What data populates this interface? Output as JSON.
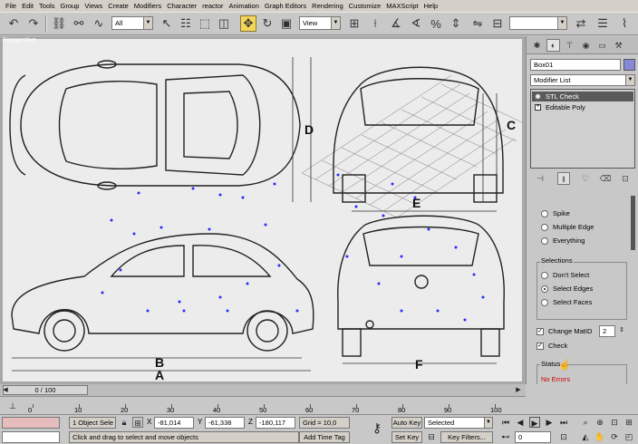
{
  "menu": [
    "File",
    "Edit",
    "Tools",
    "Group",
    "Views",
    "Create",
    "Modifiers",
    "Character",
    "reactor",
    "Animation",
    "Graph Editors",
    "Rendering",
    "Customize",
    "MAXScript",
    "Help"
  ],
  "toolbar": {
    "selection_filter": "All",
    "ref_coord": "View",
    "named_sets": ""
  },
  "viewport": {
    "label": "Perspective",
    "blueprint_labels": {
      "top_dim": "D",
      "front_dim": "C",
      "front_width": "E",
      "side_len_b": "B",
      "side_len_a": "A",
      "rear_width": "F"
    }
  },
  "panel": {
    "object_name": "Box01",
    "object_color": "#8888d8",
    "modifier_list": "Modifier List",
    "stack": [
      "STL Check",
      "Editable Poly"
    ],
    "check_options": [
      "Spike",
      "Multiple Edge",
      "Everything"
    ],
    "selections_label": "Selections",
    "selections": [
      "Don't Select",
      "Select Edges",
      "Select Faces"
    ],
    "selected_option": "Select Edges",
    "change_matid_label": "Change MatID",
    "change_matid_value": "2",
    "check_label": "Check",
    "status_label": "Status",
    "status_text": "No Errors",
    "status_color": "#cc0000"
  },
  "time": {
    "frame": "0 / 100",
    "ticks": [
      "0",
      "10",
      "20",
      "30",
      "40",
      "50",
      "60",
      "70",
      "80",
      "90",
      "100"
    ]
  },
  "status": {
    "selection": "1 Object Sele",
    "x": "-81,014",
    "y": "-61,338",
    "z": "-180,117",
    "grid": "Grid = 10,0",
    "prompt": "Click and drag to select and move objects",
    "add_time_tag": "Add Time Tag",
    "auto_key": "Auto Key",
    "set_key": "Set Key",
    "key_mode": "Selected",
    "key_filters": "Key Filters...",
    "current_frame": "0"
  }
}
